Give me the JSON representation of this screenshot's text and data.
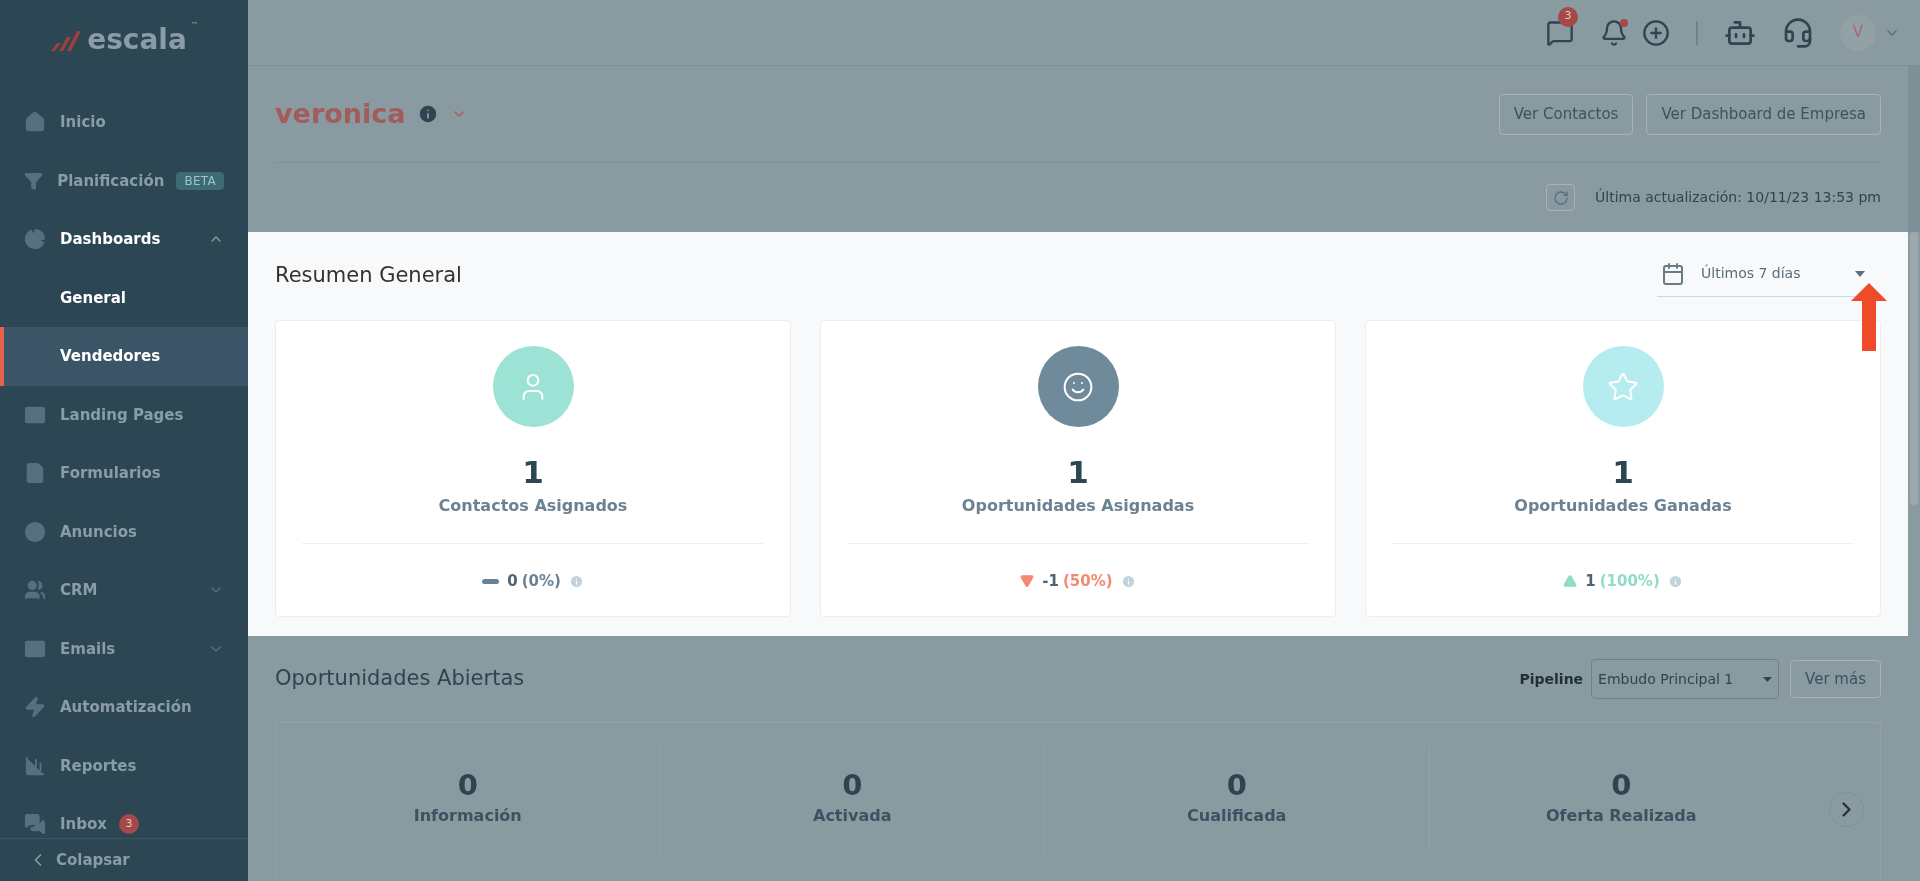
{
  "sidebar": {
    "logo": {
      "text": "escala",
      "mark": "™"
    },
    "items": [
      {
        "kind": "item",
        "label": "Inicio",
        "selected": false
      },
      {
        "kind": "item",
        "label": "Planificación",
        "badge": "BETA",
        "selected": false
      },
      {
        "kind": "group",
        "label": "Dashboards",
        "expanded": true,
        "selected": false
      },
      {
        "kind": "sub",
        "label": "General",
        "selected": false
      },
      {
        "kind": "sub",
        "label": "Vendedores",
        "selected": true
      },
      {
        "kind": "item",
        "label": "Landing Pages",
        "selected": false
      },
      {
        "kind": "item",
        "label": "Formularios",
        "selected": false
      },
      {
        "kind": "item",
        "label": "Anuncios",
        "selected": false
      },
      {
        "kind": "group",
        "label": "CRM",
        "expanded": false,
        "selected": false
      },
      {
        "kind": "group",
        "label": "Emails",
        "expanded": false,
        "selected": false
      },
      {
        "kind": "item",
        "label": "Automatización",
        "selected": false
      },
      {
        "kind": "item",
        "label": "Reportes",
        "selected": false
      },
      {
        "kind": "item",
        "label": "Inbox",
        "count": "3",
        "selected": false
      }
    ],
    "collapse": "Colapsar"
  },
  "topbar": {
    "chat_count": "3",
    "notifications_unread": true,
    "avatar": "V"
  },
  "header": {
    "user": "veronica",
    "buttons": [
      "Ver Contactos",
      "Ver Dashboard de Empresa"
    ],
    "last_update": "Última actualización: 10/11/23 13:53 pm"
  },
  "summary": {
    "title": "Resumen General",
    "period": "Últimos 7 días",
    "cards": [
      {
        "value": "1",
        "label": "Contactos Asignados",
        "color": "#9de3d5",
        "trend": {
          "kind": "flat",
          "value": "0",
          "percent": "(0%)"
        }
      },
      {
        "value": "1",
        "label": "Oportunidades Asignadas",
        "color": "#6f8a9b",
        "trend": {
          "kind": "down",
          "value": "-1",
          "percent": "(50%)"
        }
      },
      {
        "value": "1",
        "label": "Oportunidades Ganadas",
        "color": "#b4ecef",
        "trend": {
          "kind": "up",
          "value": "1",
          "percent": "(100%)"
        }
      }
    ]
  },
  "opportunities": {
    "title": "Oportunidades Abiertas",
    "pipeline_label": "Pipeline",
    "pipeline": "Embudo Principal 1",
    "more": "Ver más",
    "stages": [
      {
        "value": "0",
        "label": "Información"
      },
      {
        "value": "0",
        "label": "Activada"
      },
      {
        "value": "0",
        "label": "Cualificada"
      },
      {
        "value": "0",
        "label": "Oferta Realizada"
      }
    ]
  }
}
